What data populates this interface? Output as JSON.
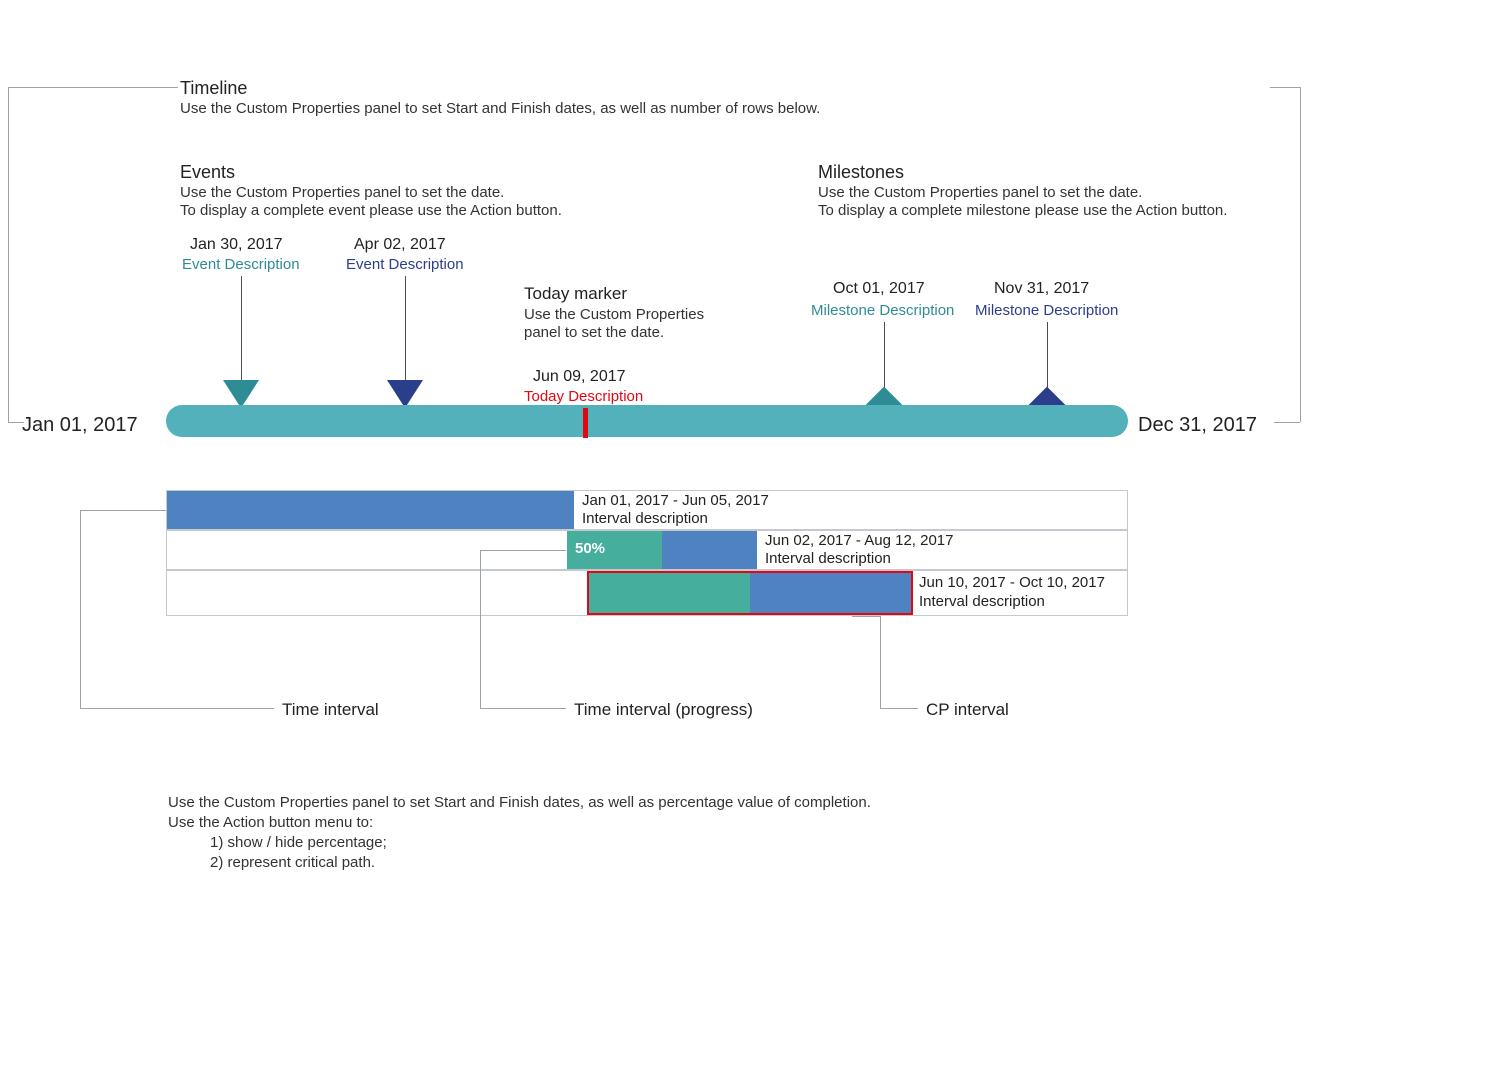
{
  "sections": {
    "timeline": {
      "title": "Timeline",
      "desc": "Use the Custom Properties panel to set Start and Finish dates, as well as number of rows below."
    },
    "events": {
      "title": "Events",
      "desc1": "Use the Custom Properties panel to set the date.",
      "desc2": "To display a complete event please use the Action button."
    },
    "milestones": {
      "title": "Milestones",
      "desc1": "Use the Custom Properties panel to set the date.",
      "desc2": "To display a complete milestone please use the Action button."
    },
    "today": {
      "title": "Today marker",
      "desc1": "Use the Custom Properties",
      "desc2": "panel to set the date.",
      "date": "Jun 09, 2017",
      "label": "Today Description"
    }
  },
  "range": {
    "start": "Jan 01, 2017",
    "end": "Dec 31, 2017"
  },
  "events": {
    "e1": {
      "date": "Jan 30, 2017",
      "label": "Event Description"
    },
    "e2": {
      "date": "Apr 02, 2017",
      "label": "Event Description"
    }
  },
  "milestones": {
    "m1": {
      "date": "Oct 01, 2017",
      "label": "Milestone Description"
    },
    "m2": {
      "date": "Nov 31, 2017",
      "label": "Milestone Description"
    }
  },
  "intervals": {
    "i1": {
      "range": "Jan 01, 2017 - Jun 05, 2017",
      "label": "Interval description"
    },
    "i2": {
      "range": "Jun 02, 2017 - Aug 12, 2017",
      "label": "Interval description",
      "progress": "50%"
    },
    "i3": {
      "range": "Jun 10, 2017 - Oct 10, 2017",
      "label": "Interval description"
    }
  },
  "callouts": {
    "time_interval": "Time interval",
    "progress_interval": "Time interval (progress)",
    "cp_interval": "CP interval"
  },
  "footer": {
    "l1": "Use the Custom Properties panel to set Start and Finish dates, as well as percentage value of completion.",
    "l2": "Use the Action button menu to:",
    "l3": "1) show / hide percentage;",
    "l4": "2) represent critical path."
  },
  "colors": {
    "timeline": "#52B1BA",
    "bar_blue": "#4E82C0",
    "bar_green": "#45AE9D",
    "accent_red": "#E30613",
    "tri_teal": "#2E8C95",
    "tri_navy": "#2A3E8B"
  }
}
